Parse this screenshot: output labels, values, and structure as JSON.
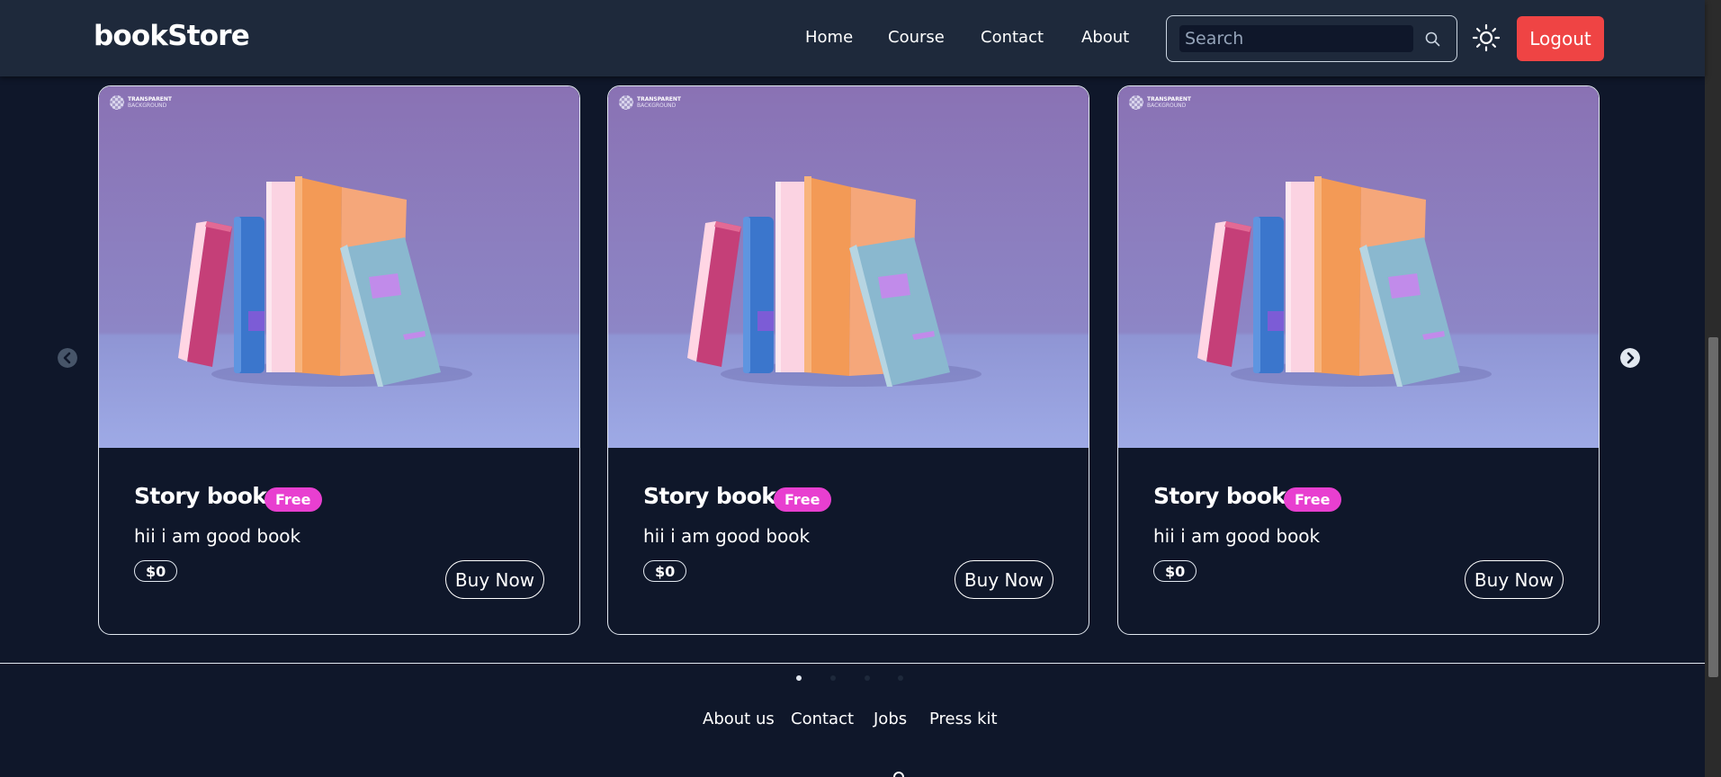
{
  "navbar": {
    "logo": "bookStore",
    "links": [
      "Home",
      "Course",
      "Contact",
      "About"
    ],
    "search_placeholder": "Search",
    "logout_label": "Logout",
    "icons": [
      "search-icon",
      "sun-icon"
    ]
  },
  "carousel": {
    "cards": [
      {
        "title": "Story book",
        "badge": "Free",
        "description": "hii i am good book",
        "price": "$0",
        "button": "Buy Now",
        "image_tag": [
          "TRANSPARENT",
          "BACKGROUND"
        ]
      },
      {
        "title": "Story book",
        "badge": "Free",
        "description": "hii i am good book",
        "price": "$0",
        "button": "Buy Now",
        "image_tag": [
          "TRANSPARENT",
          "BACKGROUND"
        ]
      },
      {
        "title": "Story book",
        "badge": "Free",
        "description": "hii i am good book",
        "price": "$0",
        "button": "Buy Now",
        "image_tag": [
          "TRANSPARENT",
          "BACKGROUND"
        ]
      }
    ],
    "dots": {
      "count": 4,
      "active_index": 0
    },
    "icons": [
      "arrow-left-icon",
      "arrow-right-icon"
    ]
  },
  "footer": {
    "links": [
      "About us",
      "Contact",
      "Jobs",
      "Press kit"
    ]
  },
  "colors": {
    "background": "#0f172a",
    "navbar": "#1e293b",
    "logout": "#ef4444",
    "badge": "#e83fd0",
    "image_bg_top": "#8a72b4",
    "image_bg_bottom": "#9aa5e0"
  }
}
